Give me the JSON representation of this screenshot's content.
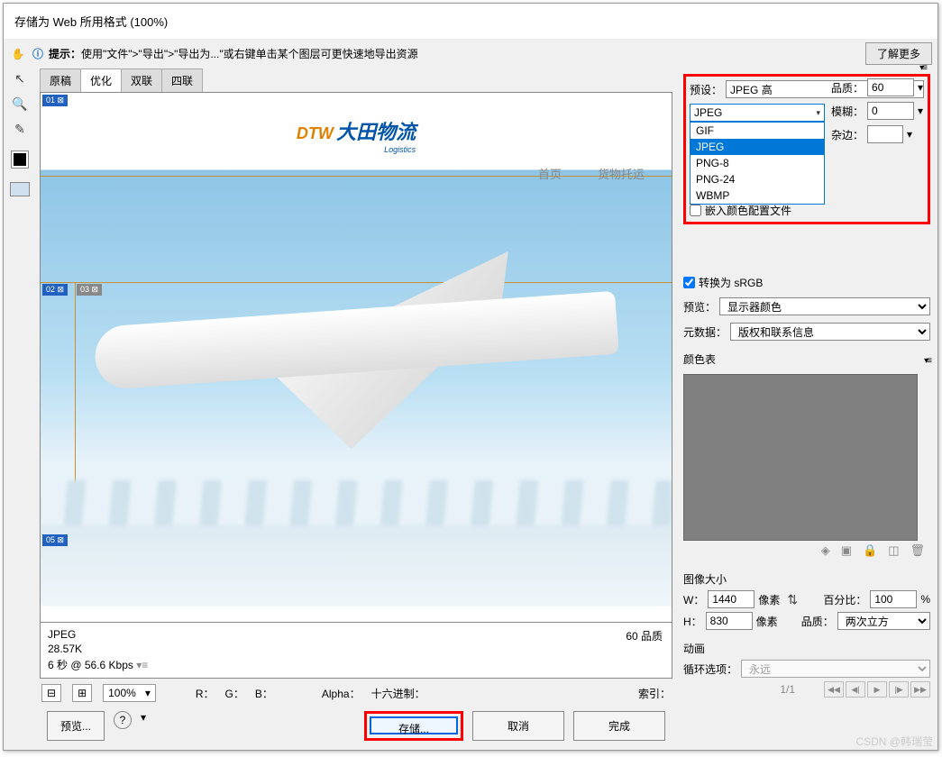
{
  "title": "存储为 Web 所用格式 (100%)",
  "tipbar": {
    "hint_label": "提示：",
    "hint_text": "使用\"文件\">\"导出\">\"导出为...\"或右键单击某个图层可更快速地导出资源",
    "learn_more": "了解更多"
  },
  "tabs": {
    "t1": "原稿",
    "t2": "优化",
    "t3": "双联",
    "t4": "四联"
  },
  "canvas": {
    "logo_brand": "DTW",
    "logo_cn": "大田物流",
    "logo_en": "Logistics",
    "nav_home": "首页",
    "nav_ship": "货物托运",
    "slice01": "01",
    "slice02": "02",
    "slice03": "03",
    "slice05": "05"
  },
  "status": {
    "fmt": "JPEG",
    "size": "28.57K",
    "time": "6 秒 @ 56.6 Kbps",
    "quality": "60 品质"
  },
  "zoomrow": {
    "zoom": "100%",
    "r": "R：",
    "g": "G：",
    "b": "B：",
    "alpha": "Alpha：",
    "hex": "十六进制：",
    "idx": "索引："
  },
  "bottom": {
    "preview": "预览...",
    "save": "存储...",
    "cancel": "取消",
    "done": "完成"
  },
  "panel": {
    "preset_label": "预设：",
    "preset_value": "JPEG 高",
    "fmt_current": "JPEG",
    "fmt_options": {
      "o1": "GIF",
      "o2": "JPEG",
      "o3": "PNG-8",
      "o4": "PNG-24",
      "o5": "WBMP"
    },
    "embed_profile": "嵌入颜色配置文件",
    "quality_label": "品质：",
    "quality_value": "60",
    "blur_label": "模糊：",
    "blur_value": "0",
    "matte_label": "杂边：",
    "srgb": "转换为 sRGB",
    "preview_label": "预览：",
    "preview_value": "显示器颜色",
    "meta_label": "元数据：",
    "meta_value": "版权和联系信息",
    "colortable": "颜色表",
    "imgsize": "图像大小",
    "w_label": "W：",
    "w_value": "1440",
    "px": "像素",
    "h_label": "H：",
    "h_value": "830",
    "percent_label": "百分比：",
    "percent_value": "100",
    "percent_sym": "%",
    "q2_label": "品质：",
    "q2_value": "两次立方",
    "anim": "动画",
    "loop_label": "循环选项：",
    "loop_value": "永远",
    "page": "1/1"
  },
  "watermark": "CSDN @韩瑞莹"
}
